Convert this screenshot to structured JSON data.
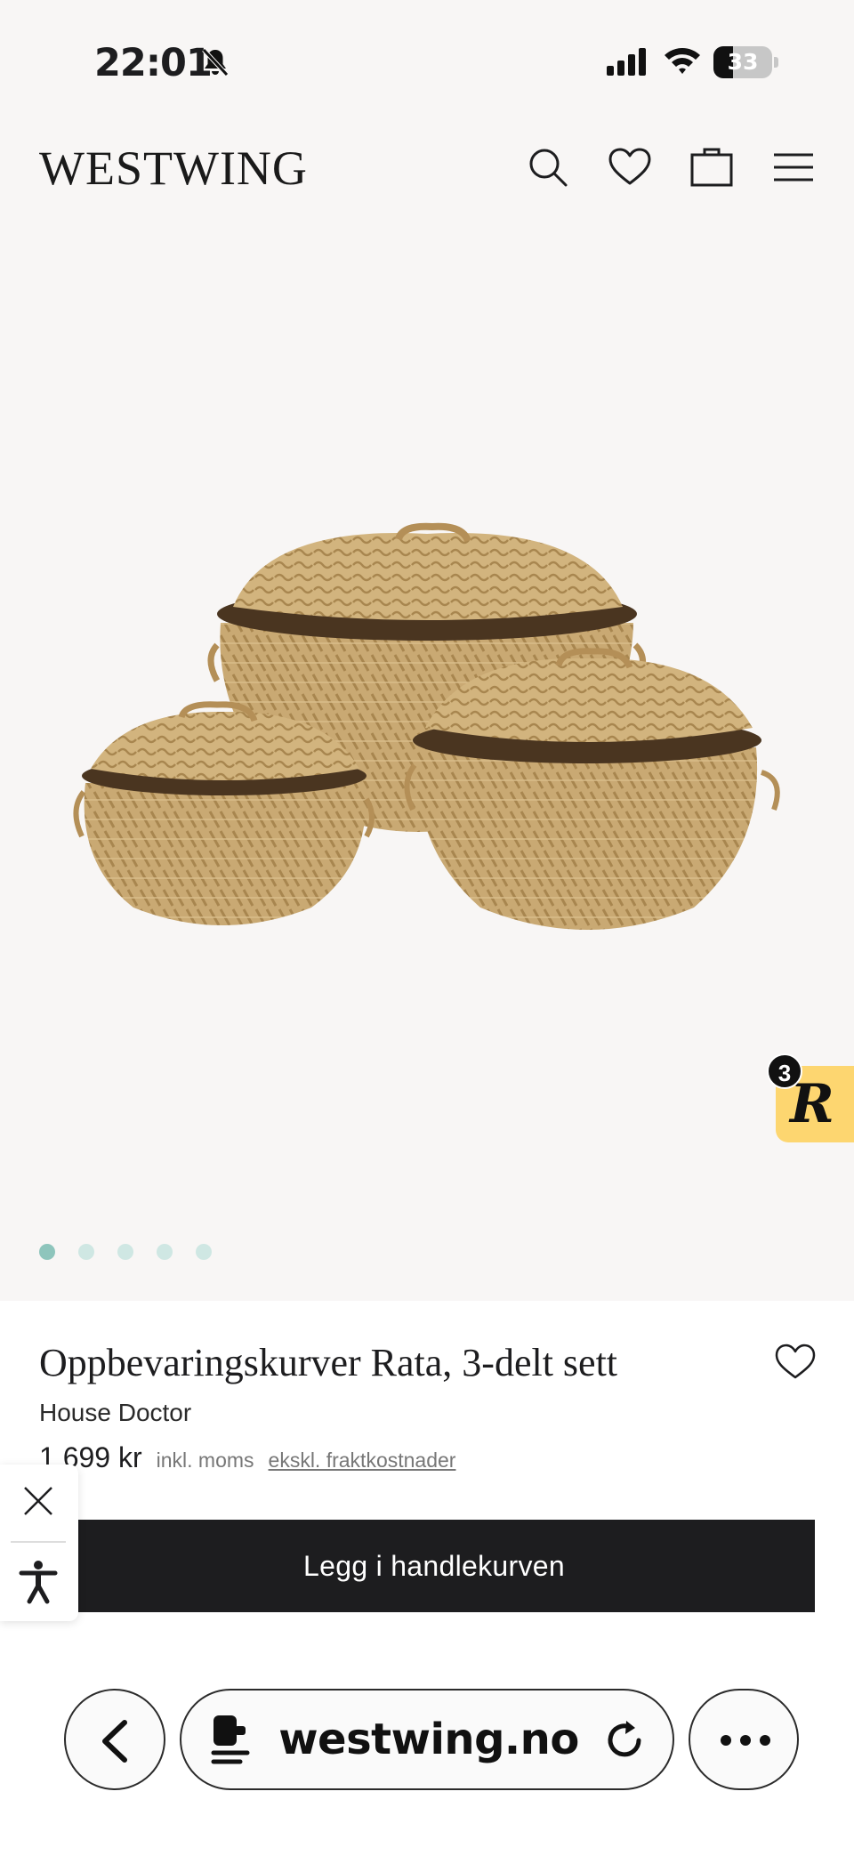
{
  "status_bar": {
    "time": "22:01",
    "battery_level": "33",
    "battery_fraction": 0.33,
    "icons": [
      "bell-slash-icon",
      "cellular-signal-icon",
      "wifi-icon",
      "battery-icon"
    ]
  },
  "header": {
    "logo": "WESTWING",
    "icons": [
      "search-icon",
      "heart-icon",
      "shopping-bag-icon",
      "menu-icon"
    ]
  },
  "gallery": {
    "image_count": 5,
    "active_index": 0,
    "reviews_count": "3",
    "reviews_badge_letter": "R",
    "reviews_badge_color": "#fdd670",
    "dot_active_color": "#8ec5bc",
    "dot_color": "#cfe7e3"
  },
  "product": {
    "title": "Oppbevaringskurver Rata, 3-delt sett",
    "brand": "House Doctor",
    "price": "1 699 kr",
    "vat_note": "inkl. moms",
    "shipping_note": "ekskl. fraktkostnader",
    "add_to_cart_label": "Legg i handlekurven"
  },
  "accessibility_widget": {
    "icons": [
      "close-icon",
      "accessibility-person-icon"
    ]
  },
  "browser": {
    "url": "westwing.no",
    "icons": [
      "back-icon",
      "reader-icon",
      "reload-icon",
      "more-icon"
    ]
  }
}
